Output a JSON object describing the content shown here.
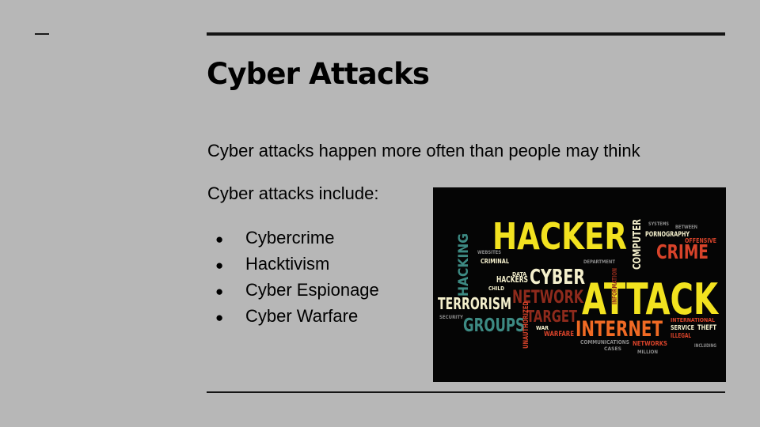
{
  "slide": {
    "title": "Cyber Attacks",
    "intro": "Cyber attacks happen more often than people may think",
    "include_heading": "Cyber attacks include:",
    "bullets": [
      "Cybercrime",
      "Hacktivism",
      "Cyber Espionage",
      "Cyber Warfare"
    ],
    "bullet_glyph": "●"
  },
  "word_cloud": {
    "words": {
      "hacker": "HACKER",
      "attack": "ATTACK",
      "cyber": "CYBER",
      "internet": "INTERNET",
      "terrorism": "TERRORISM",
      "groups": "GROUPS",
      "network": "NETWORK",
      "crime": "CRIME",
      "target": "TARGET",
      "hacking": "HACKING",
      "computer": "COMPUTER",
      "pornography": "PORNOGRAPHY",
      "offensive": "OFFENSIVE",
      "hackers": "HACKERS",
      "criminal": "CRIMINAL",
      "warfare": "WARFARE",
      "communications": "COMMUNICATIONS",
      "networks": "NETWORKS",
      "international": "INTERNATIONAL",
      "service": "SERVICE",
      "theft": "THEFT",
      "illegal": "ILLEGAL",
      "unauthorized": "UNAUTHORIZED",
      "information": "INFORMATION",
      "data": "DATA",
      "child": "CHILD",
      "websites": "WEBSITES",
      "systems": "SYSTEMS",
      "department": "DEPARTMENT",
      "including": "INCLUDING",
      "cases": "CASES",
      "million": "MILLION",
      "security": "SECURITY",
      "war": "WAR",
      "between": "BETWEEN"
    },
    "colors": {
      "background": "#050505",
      "yellow": "#f2e21f",
      "red": "#d8432a",
      "orange": "#f06a24",
      "teal": "#3d8a83",
      "cream": "#f4efcc",
      "dark_red": "#8e2a1c",
      "gray": "#8a8a8a"
    }
  }
}
